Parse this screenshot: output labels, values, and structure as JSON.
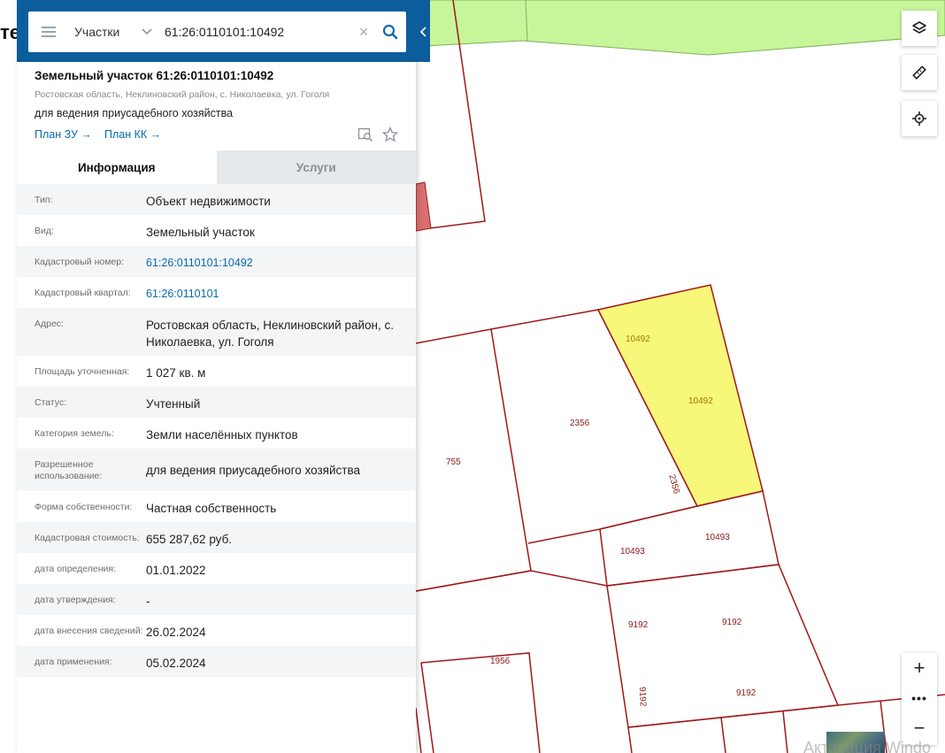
{
  "background": {
    "partial_title": "те"
  },
  "search": {
    "type_label": "Участки",
    "value": "61:26:0110101:10492",
    "clear_glyph": "×"
  },
  "object": {
    "title": "Земельный участок 61:26:0110101:10492",
    "address": "Ростовская область, Неклиновский район, с. Николаевка, ул. Гоголя",
    "purpose": "для ведения приусадебного хозяйства",
    "plan_zu": "План ЗУ →",
    "plan_kk": "План КК →"
  },
  "tabs": {
    "info": "Информация",
    "services": "Услуги"
  },
  "info": {
    "type": {
      "k": "Тип:",
      "v": "Объект недвижимости"
    },
    "kind": {
      "k": "Вид:",
      "v": "Земельный участок"
    },
    "cad_number": {
      "k": "Кадастровый номер:",
      "v": "61:26:0110101:10492"
    },
    "cad_quarter": {
      "k": "Кадастровый квартал:",
      "v": "61:26:0110101"
    },
    "address": {
      "k": "Адрес:",
      "v": "Ростовская область, Неклиновский район, с. Николаевка, ул. Гоголя"
    },
    "area": {
      "k": "Площадь уточненная:",
      "v": "1 027 кв. м"
    },
    "status": {
      "k": "Статус:",
      "v": "Учтенный"
    },
    "category": {
      "k": "Категория земель:",
      "v": "Земли населённых пунктов"
    },
    "allowed_use": {
      "k": "Разрешенное использование:",
      "v": "для ведения приусадебного хозяйства"
    },
    "ownership": {
      "k": "Форма собственности:",
      "v": "Частная собственность"
    },
    "cad_value": {
      "k": "Кадастровая стоимость:",
      "v": "655 287,62 руб."
    },
    "date_determined": {
      "k": "дата определения:",
      "v": "01.01.2022"
    },
    "date_approved": {
      "k": "дата утверждения:",
      "v": "-"
    },
    "date_entered": {
      "k": "дата внесения сведений:",
      "v": "26.02.2024"
    },
    "date_applied": {
      "k": "дата применения:",
      "v": "05.02.2024"
    }
  },
  "map": {
    "labels": {
      "p10492_a": "10492",
      "p10492_b": "10492",
      "p2356_a": "2356",
      "p2356_b": "2356",
      "p755": "755",
      "p10493_a": "10493",
      "p10493_b": "10493",
      "p9192_a": "9192",
      "p9192_b": "9192",
      "p9192_c": "9192",
      "p9192_d": "9192",
      "p1956": "1956"
    },
    "zoom_in": "+",
    "zoom_more": "•••",
    "zoom_out": "−",
    "watermark": "Активация Windo"
  },
  "colors": {
    "header": "#0b5d9c",
    "link": "#0b6aab",
    "parcel_border": "#a01818",
    "selected_parcel": "#f7f77a",
    "green_zone": "#c6f59a"
  },
  "icons": {
    "menu": "menu-icon",
    "search": "search-icon",
    "layers": "layers-icon",
    "ruler": "ruler-icon",
    "locate": "locate-icon",
    "preview": "preview-icon",
    "star": "star-icon"
  }
}
